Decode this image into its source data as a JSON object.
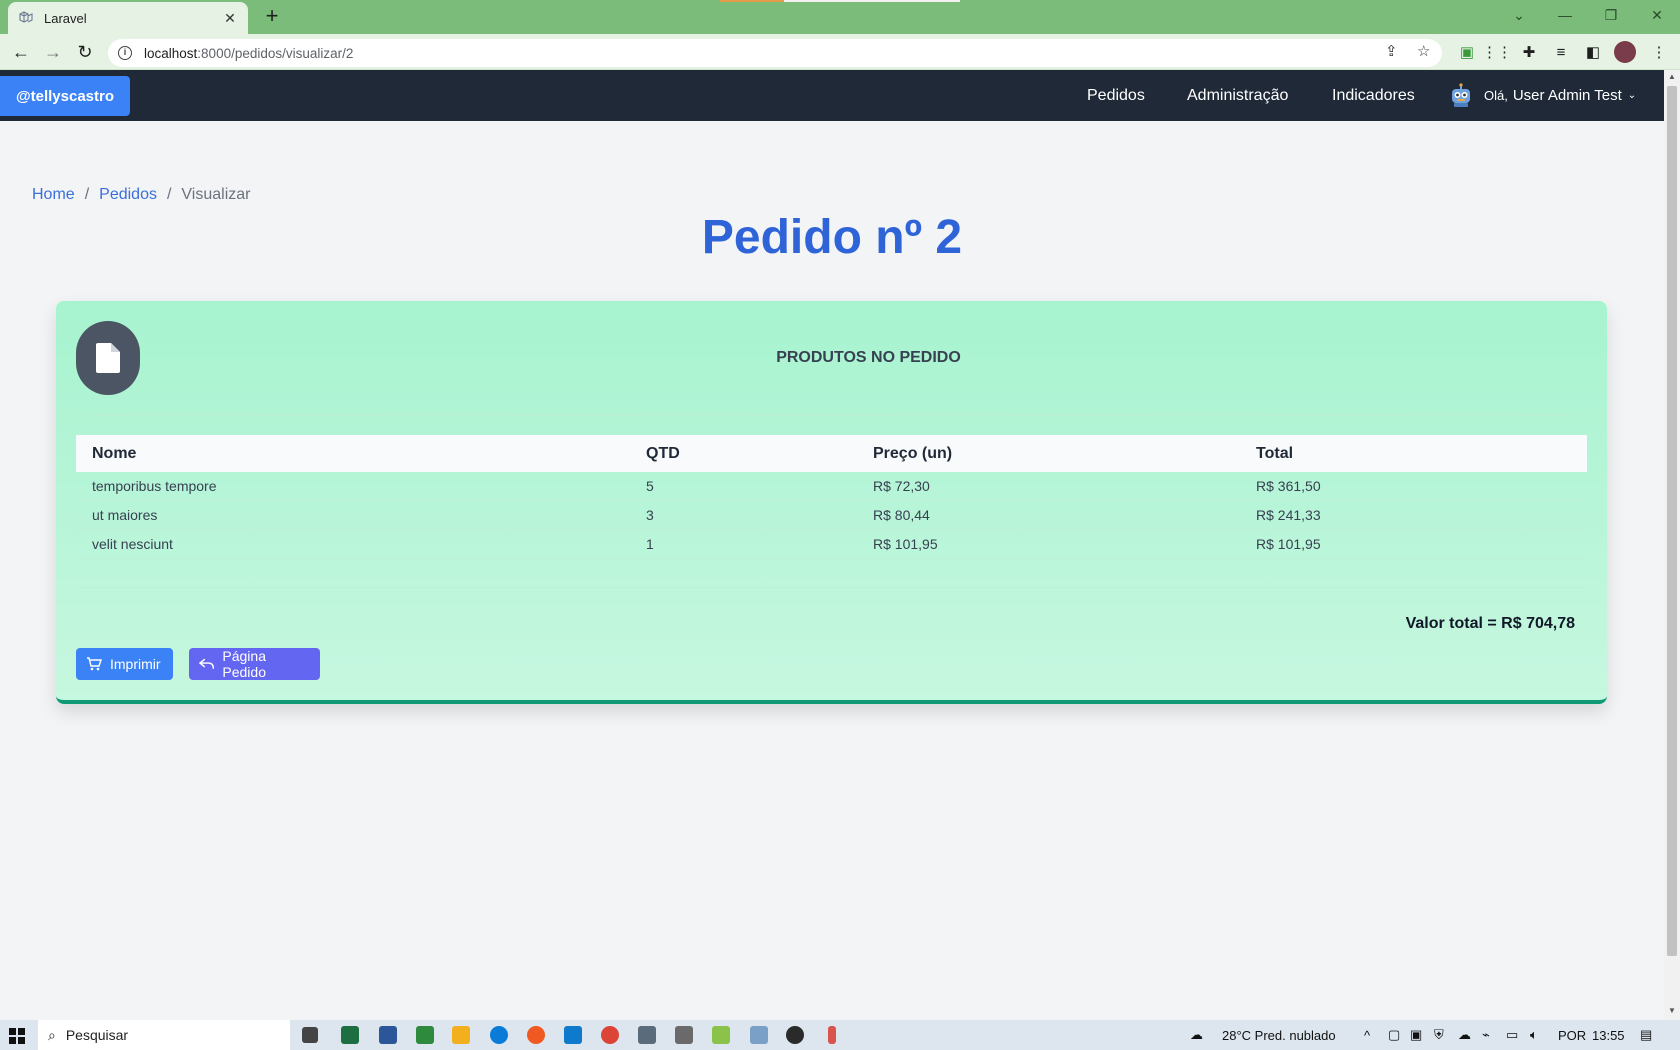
{
  "browser": {
    "tab_title": "Laravel",
    "tab_close": "✕",
    "new_tab": "+",
    "url_host": "localhost",
    "url_path": ":8000/pedidos/visualizar/2"
  },
  "navbar": {
    "brand": "@tellyscastro",
    "links": [
      "Pedidos",
      "Administração",
      "Indicadores"
    ],
    "user_greeting": "Olá,",
    "user_name": "User Admin Test"
  },
  "breadcrumb": {
    "home": "Home",
    "pedidos": "Pedidos",
    "current": "Visualizar",
    "separator": "/"
  },
  "page": {
    "title": "Pedido nº 2"
  },
  "card": {
    "heading": "PRODUTOS NO PEDIDO",
    "columns": [
      "Nome",
      "QTD",
      "Preço (un)",
      "Total"
    ],
    "rows": [
      [
        "temporibus tempore",
        "5",
        "R$ 72,30",
        "R$ 361,50"
      ],
      [
        "ut maiores",
        "3",
        "R$ 80,44",
        "R$ 241,33"
      ],
      [
        "velit nesciunt",
        "1",
        "R$ 101,95",
        "R$ 101,95"
      ]
    ],
    "total_label": "Valor total = R$ 704,78",
    "print_label": "Imprimir",
    "back_label": "Página Pedido"
  },
  "taskbar": {
    "search_placeholder": "Pesquisar",
    "weather": "28°C  Pred. nublado",
    "lang": "POR",
    "time": "13:55"
  },
  "colors": {
    "navbar_bg": "#1f2937",
    "brand_bg": "#3b82f6",
    "title": "#2f63d8",
    "card_top": "#a7f3d0",
    "card_border": "#0f9a75",
    "print_button": "#3b82f6",
    "back_button": "#6366f1"
  }
}
